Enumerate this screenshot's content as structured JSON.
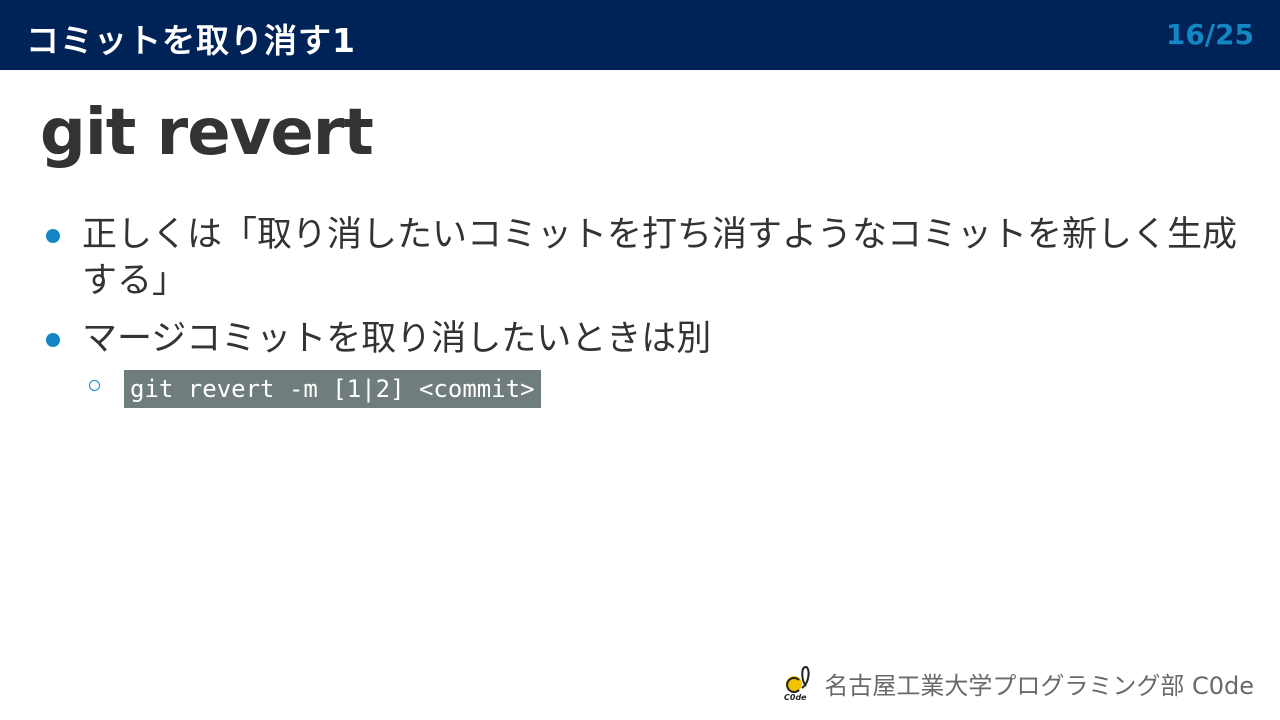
{
  "header": {
    "section_title": "コミットを取り消す1",
    "page_counter": "16/25",
    "background_color": "#002357",
    "counter_color": "#1486c4"
  },
  "slide": {
    "heading": "git revert",
    "bullets": [
      {
        "text": "正しくは「取り消したいコミットを打ち消すようなコミットを新しく生成する」"
      },
      {
        "text": "マージコミットを取り消したいときは別"
      }
    ],
    "sub_bullets": [
      {
        "code": "git revert -m [1|2] <commit>"
      }
    ],
    "accent_color": "#1486c4",
    "code_background": "#6f7d7c"
  },
  "footer": {
    "logo_icon": "c0de-logo-icon",
    "org_text": "名古屋工業大学プログラミング部 C0de"
  }
}
